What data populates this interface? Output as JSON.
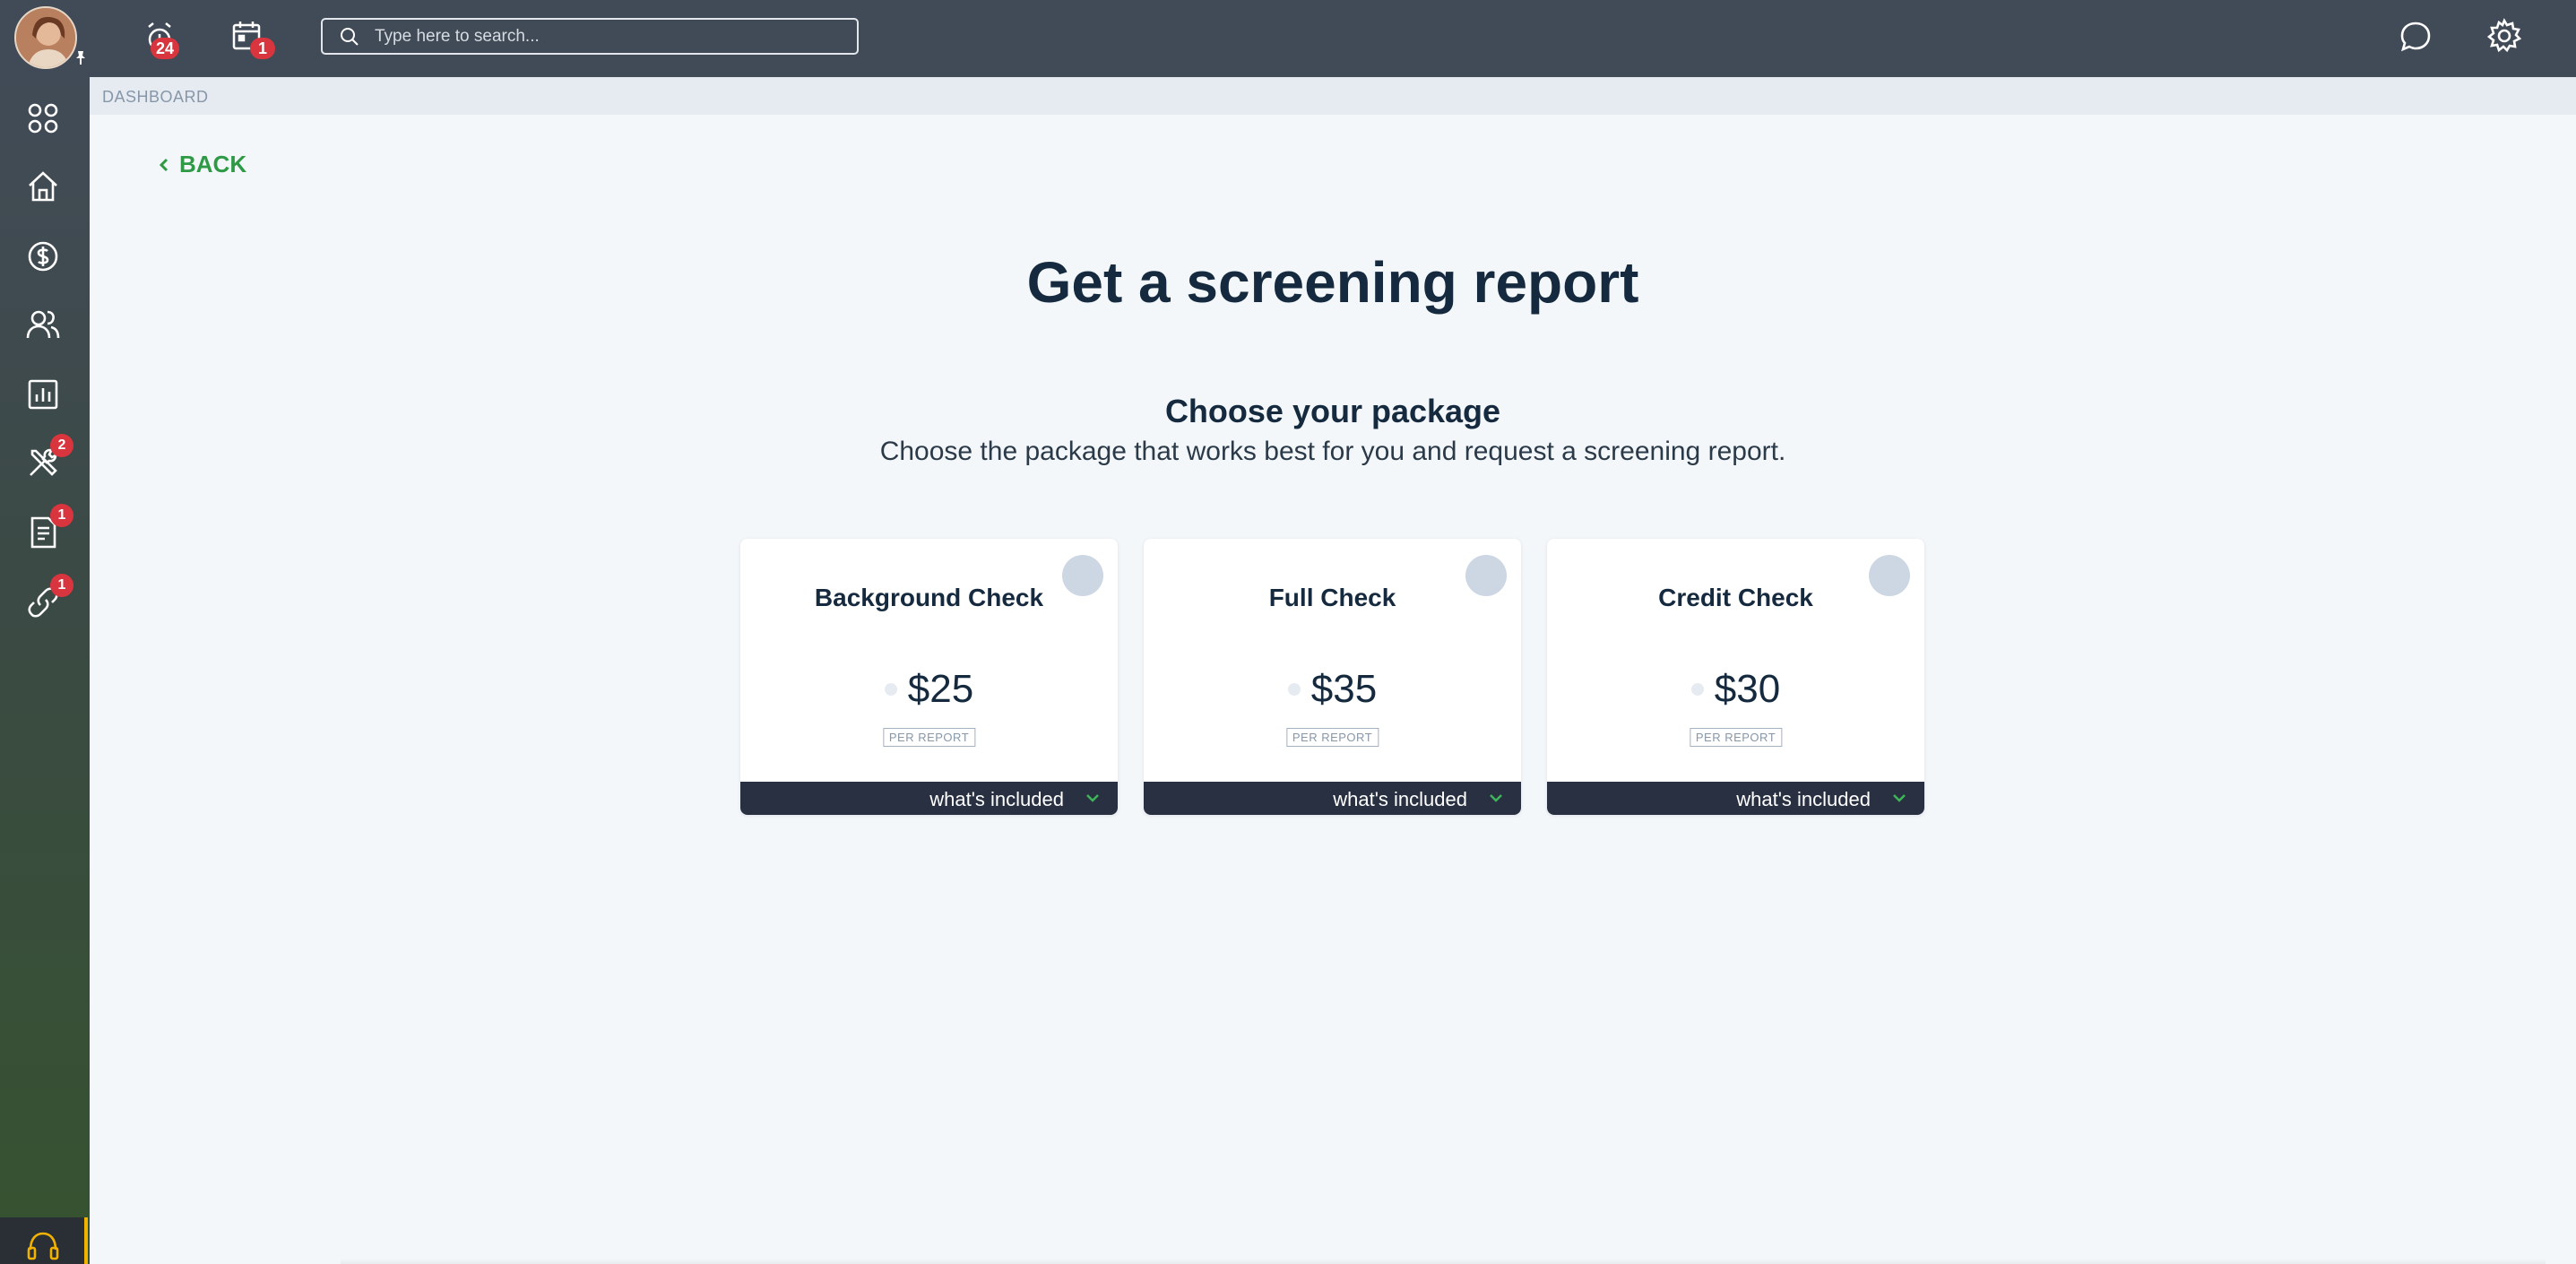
{
  "topbar": {
    "search_placeholder": "Type here to search...",
    "alerts_count": "24",
    "calendar_count": "1"
  },
  "sidebar": {
    "items": [
      {
        "icon": "dashboard-grid-icon",
        "badge": ""
      },
      {
        "icon": "home-icon",
        "badge": ""
      },
      {
        "icon": "dollar-icon",
        "badge": ""
      },
      {
        "icon": "people-icon",
        "badge": ""
      },
      {
        "icon": "bar-chart-icon",
        "badge": ""
      },
      {
        "icon": "tools-icon",
        "badge": "2"
      },
      {
        "icon": "document-icon",
        "badge": "1"
      },
      {
        "icon": "link-icon",
        "badge": "1"
      }
    ]
  },
  "breadcrumb": "DASHBOARD",
  "back_label": "BACK",
  "page": {
    "title": "Get a screening report",
    "subtitle": "Choose your package",
    "description": "Choose the package that works best for you and request a screening report."
  },
  "packages": [
    {
      "name": "Background Check",
      "price": "$25",
      "unit": "PER REPORT",
      "included_label": "what's included"
    },
    {
      "name": "Full Check",
      "price": "$35",
      "unit": "PER REPORT",
      "included_label": "what's included"
    },
    {
      "name": "Credit Check",
      "price": "$30",
      "unit": "PER REPORT",
      "included_label": "what's included"
    }
  ],
  "colors": {
    "topbar": "#414b57",
    "accent_green": "#2f9a46",
    "badge_red": "#d9353e",
    "card_footer": "#283041"
  }
}
